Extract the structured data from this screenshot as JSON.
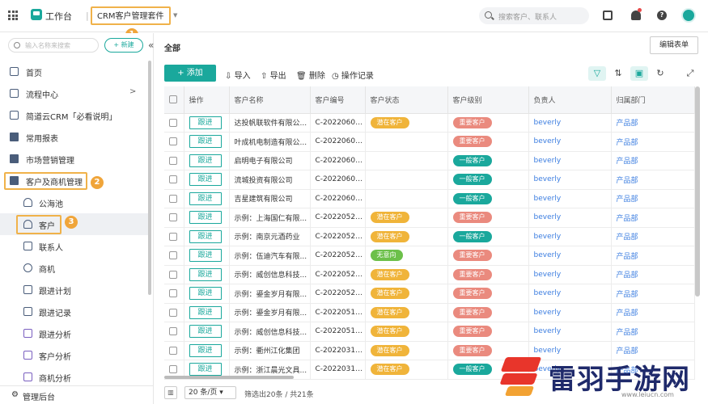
{
  "topbar": {
    "workbench": "工作台",
    "suite": "CRM客户管理套件",
    "search_placeholder": "搜索客户、联系人"
  },
  "annotations": [
    "1",
    "2",
    "3"
  ],
  "sidebar": {
    "search_placeholder": "输入名称来搜索",
    "new_label": "+ 新建",
    "items": [
      {
        "label": "首页",
        "icon": "home-icon"
      },
      {
        "label": "流程中心",
        "icon": "flow-icon",
        "arrow": ">"
      },
      {
        "label": "简道云CRM「必看说明」",
        "icon": "doc-icon"
      },
      {
        "label": "常用报表",
        "icon": "folder-icon"
      },
      {
        "label": "市场营销管理",
        "icon": "folder-icon"
      },
      {
        "label": "客户及商机管理",
        "icon": "folder-open-icon"
      },
      {
        "label": "公海池",
        "icon": "people-icon"
      },
      {
        "label": "客户",
        "icon": "person-icon"
      },
      {
        "label": "联系人",
        "icon": "contact-icon"
      },
      {
        "label": "商机",
        "icon": "target-icon"
      },
      {
        "label": "跟进计划",
        "icon": "calendar-icon"
      },
      {
        "label": "跟进记录",
        "icon": "record-icon"
      },
      {
        "label": "跟进分析",
        "icon": "analysis-icon"
      },
      {
        "label": "客户分析",
        "icon": "analysis-icon"
      },
      {
        "label": "商机分析",
        "icon": "analysis-icon"
      }
    ],
    "footer": "管理后台"
  },
  "main": {
    "title": "全部",
    "edit_form": "编辑表单",
    "add_label": "+ 添加",
    "tools": [
      "导入",
      "导出",
      "删除",
      "操作记录"
    ]
  },
  "table": {
    "headers": [
      "操作",
      "客户名称",
      "客户编号",
      "客户状态",
      "客户级别",
      "负责人",
      "归属部门"
    ],
    "follow_label": "跟进",
    "rows": [
      {
        "name": "达投帆联软件有限公...",
        "code": "C-20220607...",
        "status": "潜在客户",
        "level": "重要客户",
        "owner": "beverly",
        "dept": "产品部"
      },
      {
        "name": "叶成机电制造有限公...",
        "code": "C-20220602...",
        "status": "",
        "level": "重要客户",
        "owner": "beverly",
        "dept": "产品部"
      },
      {
        "name": "启明电子有限公司",
        "code": "C-20220602...",
        "status": "",
        "level": "一般客户",
        "owner": "beverly",
        "dept": "产品部"
      },
      {
        "name": "流城投资有限公司",
        "code": "C-20220602...",
        "status": "",
        "level": "一般客户",
        "owner": "beverly",
        "dept": "产品部"
      },
      {
        "name": "吉星建筑有限公司",
        "code": "C-20220602...",
        "status": "",
        "level": "一般客户",
        "owner": "beverly",
        "dept": "产品部"
      },
      {
        "name": "示例：上海国仁有限...",
        "code": "C-20220527...",
        "status": "潜在客户",
        "level": "重要客户",
        "owner": "beverly",
        "dept": "产品部"
      },
      {
        "name": "示例：南京元酒药业",
        "code": "C-20220527...",
        "status": "潜在客户",
        "level": "一般客户",
        "owner": "beverly",
        "dept": "产品部"
      },
      {
        "name": "示例：伍迪汽车有限...",
        "code": "C-20220527...",
        "status": "无意向",
        "level": "重要客户",
        "owner": "beverly",
        "dept": "产品部"
      },
      {
        "name": "示例：威创信息科技...",
        "code": "C-20220527...",
        "status": "潜在客户",
        "level": "重要客户",
        "owner": "beverly",
        "dept": "产品部"
      },
      {
        "name": "示例：鎏金岁月有限...",
        "code": "C-20220527...",
        "status": "潜在客户",
        "level": "重要客户",
        "owner": "beverly",
        "dept": "产品部"
      },
      {
        "name": "示例：鎏金岁月有限...",
        "code": "C-20220519...",
        "status": "潜在客户",
        "level": "重要客户",
        "owner": "beverly",
        "dept": "产品部"
      },
      {
        "name": "示例：威创信息科技...",
        "code": "C-20220519...",
        "status": "潜在客户",
        "level": "重要客户",
        "owner": "beverly",
        "dept": "产品部"
      },
      {
        "name": "示例：衢州江化集团",
        "code": "C-20220316...",
        "status": "潜在客户",
        "level": "重要客户",
        "owner": "beverly",
        "dept": "产品部"
      },
      {
        "name": "示例：浙江晨光文具...",
        "code": "C-20220313...",
        "status": "潜在客户",
        "level": "一般客户",
        "owner": "beverly",
        "dept": "产品部"
      }
    ]
  },
  "pill_colors": {
    "潜在客户": "#f0b43a",
    "无意向": "#6cc04a",
    "重要客户": "#ea8a7e",
    "一般客户": "#1aa89c"
  },
  "pager": {
    "size": "20 条/页",
    "info": "筛选出20条 / 共21条"
  },
  "watermark": {
    "text": "雷羽手游网",
    "url": "www.leiucn.com"
  }
}
